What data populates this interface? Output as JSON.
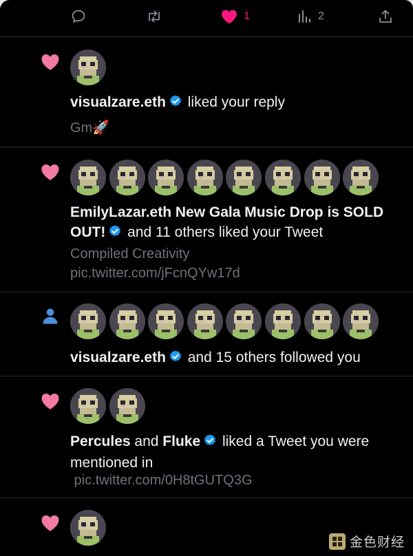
{
  "action_bar": {
    "reply_icon": "reply-icon",
    "retweet_icon": "retweet-icon",
    "like_icon": "heart-icon",
    "like_count": "1",
    "views_icon": "views-icon",
    "views_count": "2",
    "share_icon": "share-icon"
  },
  "notifications": [
    {
      "type_icon": "heart-icon",
      "avatar_count": 1,
      "name": "visualzare.eth",
      "action": " liked your reply",
      "sub": "Gm🚀"
    },
    {
      "type_icon": "heart-icon",
      "avatar_count": 8,
      "name": "EmilyLazar.eth New Gala Music Drop is SOLD OUT!",
      "action": " and 11 others liked your Tweet",
      "sub": "Compiled Creativity pic.twitter.com/jFcnQYw17d"
    },
    {
      "type_icon": "person-icon",
      "avatar_count": 8,
      "name": "visualzare.eth",
      "action": " and 15 others followed you"
    },
    {
      "type_icon": "heart-icon",
      "avatar_count": 2,
      "name": "Percules",
      "connector": " and ",
      "name2": "Fluke",
      "action": " liked a Tweet you were mentioned in",
      "sub": " pic.twitter.com/0H8tGUTQ3G"
    },
    {
      "type_icon": "heart-icon",
      "avatar_count": 1
    }
  ],
  "watermark": {
    "text": "金色财经"
  },
  "colors": {
    "background": "#000000",
    "like_pink": "#f91880",
    "follow_blue": "#1d9bf0",
    "verified_blue": "#1d9bf0",
    "muted_text": "#6e7378",
    "primary_text": "#f0f1f2"
  }
}
